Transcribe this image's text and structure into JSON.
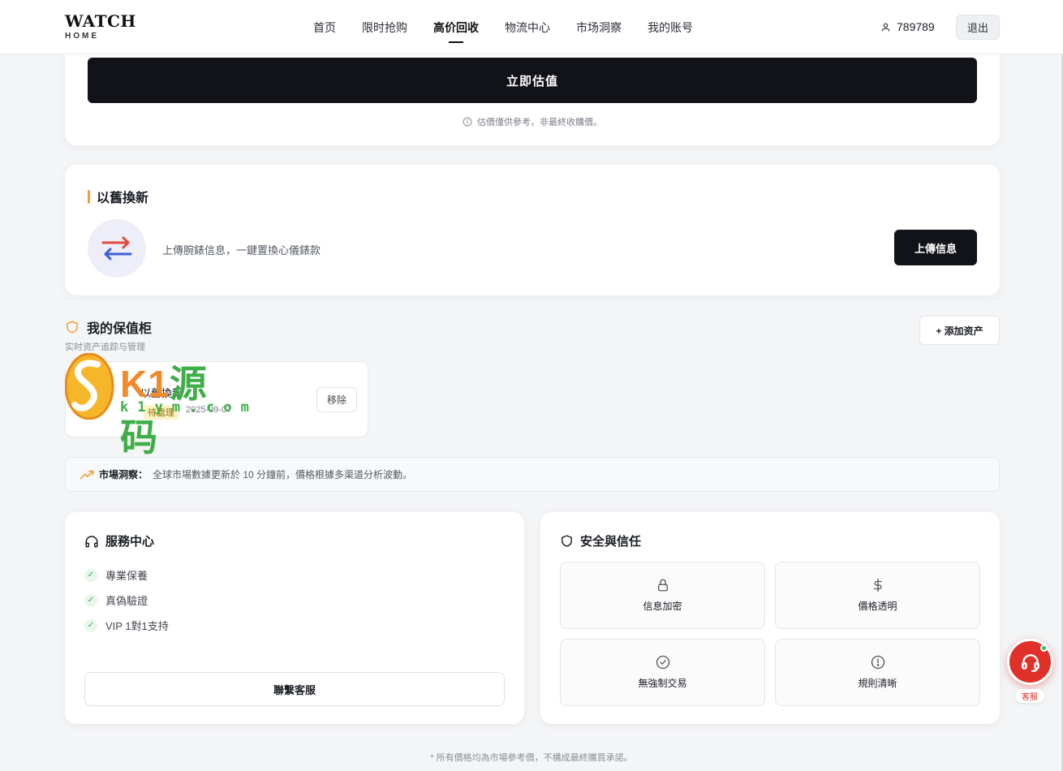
{
  "header": {
    "logo_main": "WATCH",
    "logo_sub": "HOME",
    "nav": [
      {
        "label": "首页",
        "active": false
      },
      {
        "label": "限时抢购",
        "active": false
      },
      {
        "label": "高价回收",
        "active": true
      },
      {
        "label": "物流中心",
        "active": false
      },
      {
        "label": "市场洞察",
        "active": false
      },
      {
        "label": "我的账号",
        "active": false
      }
    ],
    "username": "789789",
    "logout_label": "退出"
  },
  "estimate": {
    "button_label": "立即估值",
    "note": "估價僅供參考，非最終收購價。"
  },
  "tradein": {
    "title": "以舊換新",
    "description": "上傳腕錶信息，一鍵置換心儀錶款",
    "upload_label": "上傳信息"
  },
  "vault": {
    "title": "我的保值柜",
    "subtitle": "实时资产追踪与管理",
    "add_label": "+ 添加资产",
    "assets": [
      {
        "name": "以舊換新",
        "tag": "待處理",
        "date": "2025-09-07",
        "remove_label": "移除"
      }
    ]
  },
  "watermark": {
    "brand_k": "K1",
    "brand_rest": "源码",
    "url": "k1ym.com"
  },
  "market": {
    "label": "市場洞察：",
    "text": "全球市場數據更新於 10 分鐘前，價格根據多渠道分析波動。"
  },
  "service": {
    "title": "服務中心",
    "items": [
      "專業保養",
      "真偽驗證",
      "VIP 1對1支持"
    ],
    "contact_label": "聯繫客服"
  },
  "security": {
    "title": "安全與信任",
    "tiles": [
      {
        "label": "信息加密",
        "icon": "lock-icon"
      },
      {
        "label": "價格透明",
        "icon": "dollar-icon"
      },
      {
        "label": "無強制交易",
        "icon": "check-circle-icon"
      },
      {
        "label": "規則清晰",
        "icon": "alert-circle-icon"
      }
    ]
  },
  "footer": {
    "note": "* 所有價格均為市場參考價，不構成最終購買承諾。"
  },
  "chat": {
    "label": "客服"
  },
  "colors": {
    "accent_dark": "#111318",
    "orange": "#f0a23a",
    "chat_red": "#e0302a",
    "online_green": "#28c76f"
  }
}
